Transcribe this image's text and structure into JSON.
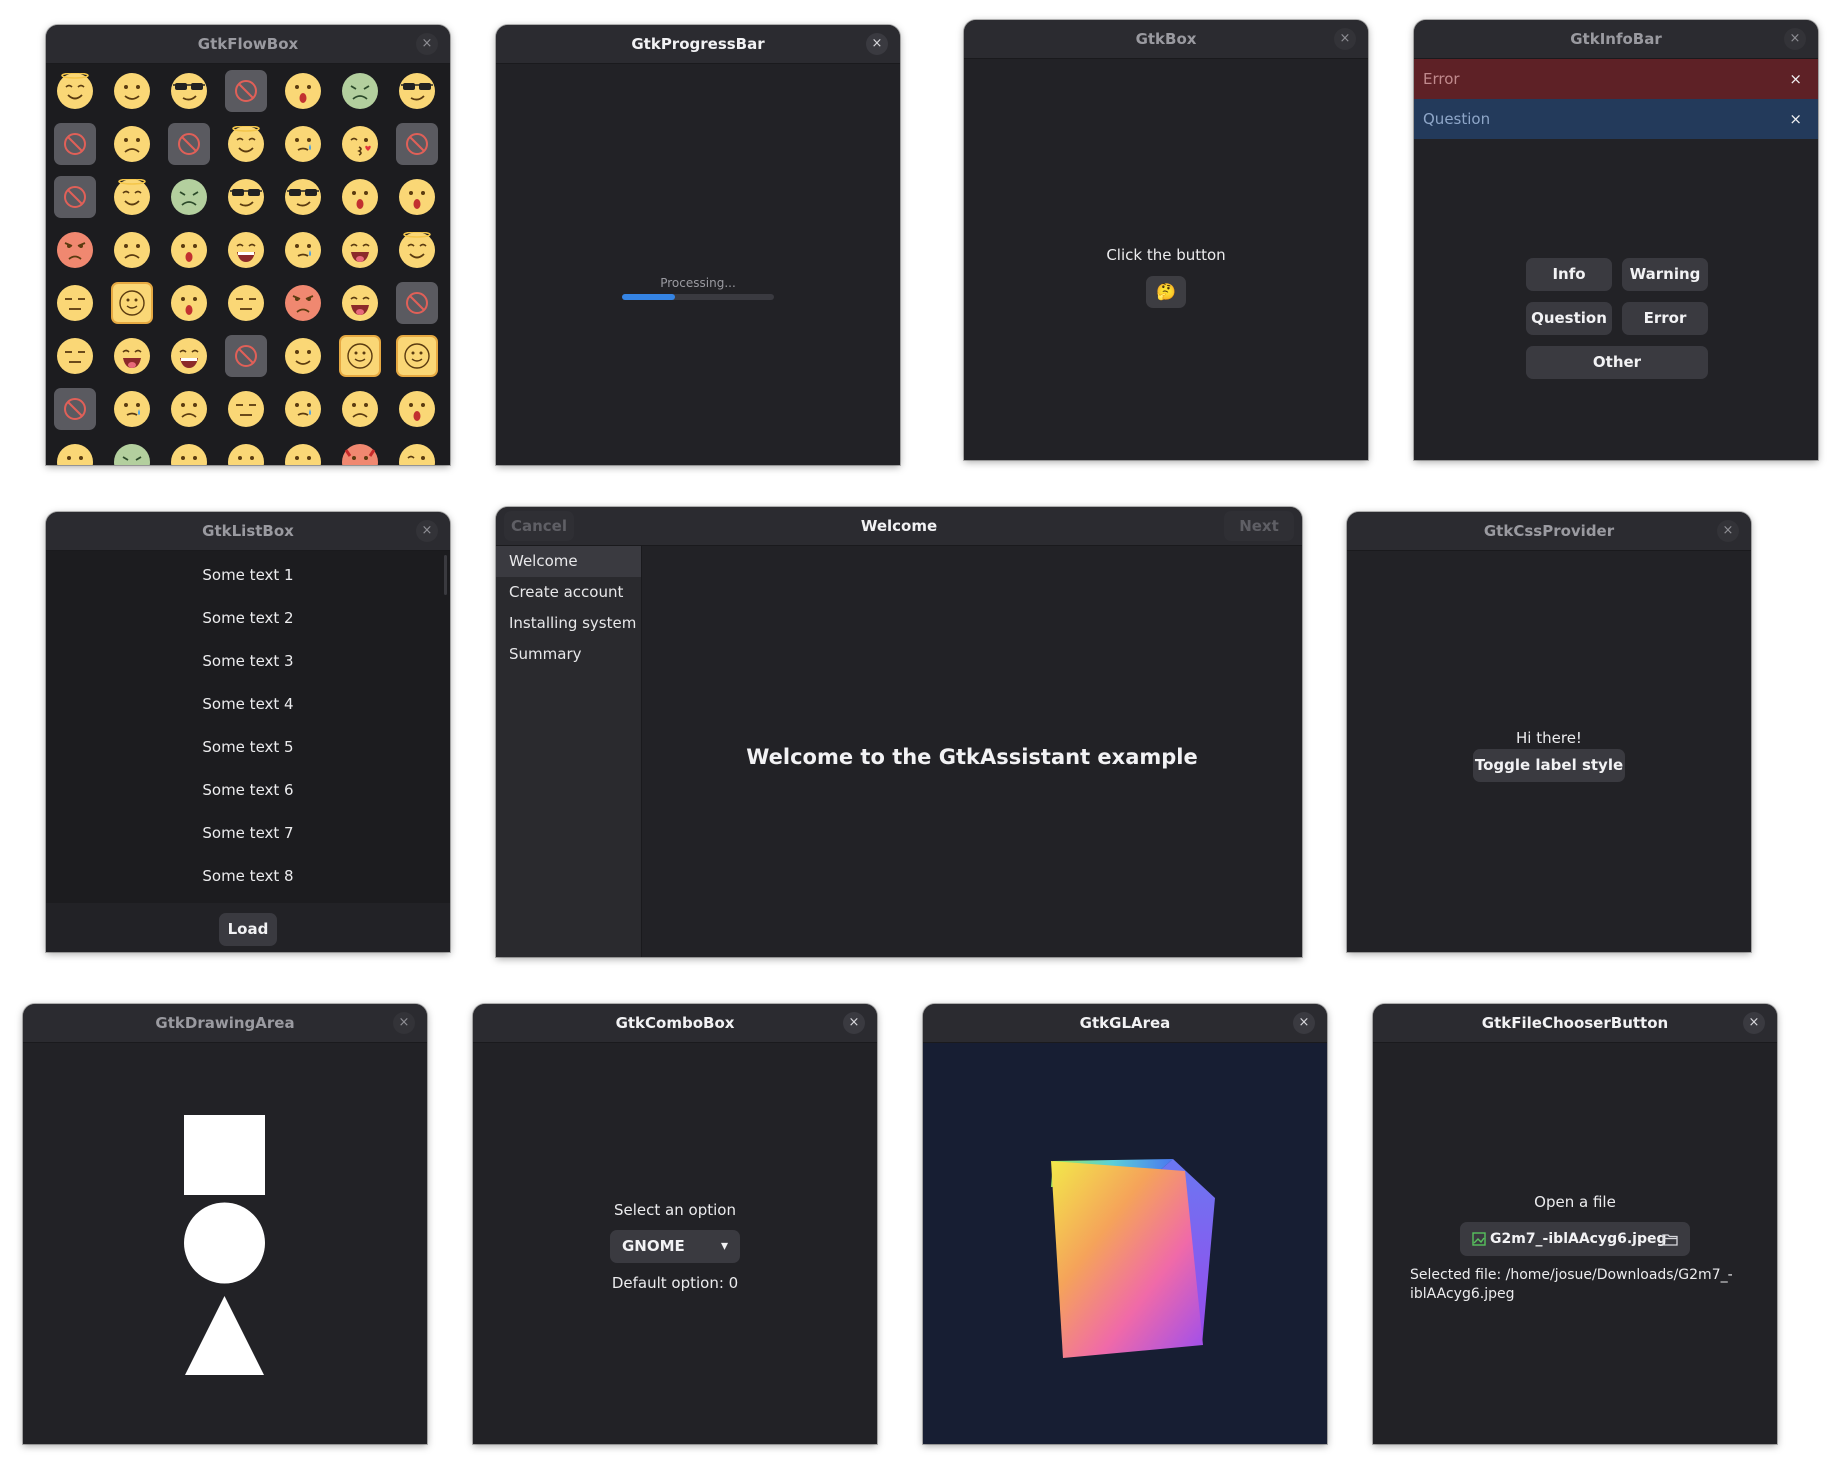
{
  "windows": {
    "flowbox": {
      "title": "GtkFlowBox"
    },
    "progress": {
      "title": "GtkProgressBar",
      "text": "Processing...",
      "fraction": 0.35
    },
    "box": {
      "title": "GtkBox",
      "label": "Click the button",
      "button_emoji": "🤔"
    },
    "infobar": {
      "title": "GtkInfoBar",
      "bars": [
        {
          "label": "Error",
          "color": "#5e2126"
        },
        {
          "label": "Question",
          "color": "#233a5b"
        }
      ],
      "buttons": [
        "Info",
        "Warning",
        "Question",
        "Error",
        "Other"
      ]
    },
    "listbox": {
      "title": "GtkListBox",
      "rows": [
        "Some text 1",
        "Some text 2",
        "Some text 3",
        "Some text 4",
        "Some text 5",
        "Some text 6",
        "Some text 7",
        "Some text 8"
      ],
      "load_label": "Load"
    },
    "assistant": {
      "title": "Welcome",
      "cancel_label": "Cancel",
      "next_label": "Next",
      "steps": [
        "Welcome",
        "Create account",
        "Installing system",
        "Summary"
      ],
      "heading": "Welcome to the GtkAssistant example"
    },
    "cssprovider": {
      "title": "GtkCssProvider",
      "label": "Hi there!",
      "button_label": "Toggle label style"
    },
    "drawingarea": {
      "title": "GtkDrawingArea"
    },
    "combobox": {
      "title": "GtkComboBox",
      "label": "Select an option",
      "selected": "GNOME",
      "default_text": "Default option: 0"
    },
    "glarea": {
      "title": "GtkGLArea"
    },
    "filechooser": {
      "title": "GtkFileChooserButton",
      "label": "Open a file",
      "file_name": "G2m7_-iblAAcyg6.jpeg",
      "selected_line1": "Selected file: /home/josue/Downloads/G2m7_-",
      "selected_line2": "iblAAcyg6.jpeg"
    }
  },
  "icons": {
    "close": "×",
    "dropdown": "▾",
    "image_file": "image-icon",
    "folder": "folder-icon"
  },
  "emoji_grid": [
    [
      "angel",
      "grin",
      "cool",
      "block",
      "wow",
      "sick",
      "cool"
    ],
    [
      "block",
      "sad",
      "block",
      "angel",
      "tear",
      "kiss",
      "block"
    ],
    [
      "block",
      "angel",
      "sick",
      "cool",
      "cool",
      "wow",
      "wow"
    ],
    [
      "angry",
      "sad",
      "wow",
      "laugh",
      "tear",
      "tongue",
      "angel"
    ],
    [
      "meh",
      "sel",
      "wow",
      "meh",
      "angry",
      "tongue",
      "block"
    ],
    [
      "meh",
      "tongue",
      "laugh",
      "block",
      "grin",
      "sel",
      "sel"
    ],
    [
      "block",
      "tear",
      "sad",
      "meh",
      "tear",
      "sad",
      "wow"
    ],
    [
      "grin",
      "sick",
      "grin",
      "grin",
      "grin",
      "devil",
      "wink"
    ]
  ]
}
